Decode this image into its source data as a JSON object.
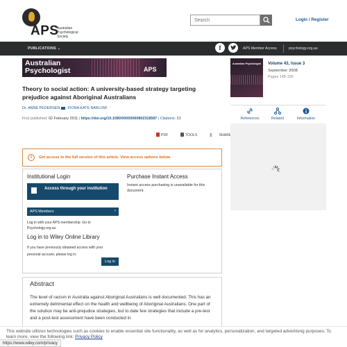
{
  "header": {
    "logo_text": "APS",
    "logo_society": "Australian Psychological Society",
    "search_placeholder": "Search",
    "login_label": "Login / Register"
  },
  "nav": {
    "publications_label": "PUBLICATIONS",
    "member_access_label": "APS Member Access",
    "site_label": "psychology.org.au",
    "facebook_glyph": "f"
  },
  "journal": {
    "banner_title_line1": "Australian",
    "banner_title_line2": "Psychologist",
    "banner_badge": "APS",
    "cover_title": "Australian Psychologist",
    "volume": "Volume 43, Issue 3",
    "issue_date": "September 2008",
    "pages": "Pages 148-159"
  },
  "article": {
    "title": "Theory to social action: A university-based strategy targeting prejudice against Aboriginal Australians",
    "author_1": "Dr. ANNE PEDERSEN",
    "author_2": "FIONA KATE BARLOW",
    "first_published_label": "First published:",
    "first_published_date": "02 February 2011",
    "doi": "https://doi.org/10.1080/00050060802318587",
    "citations": "Citations: 53"
  },
  "tools": {
    "pdf_label": "PDF",
    "tools_label": "TOOLS",
    "share_label": "SHARE"
  },
  "access": {
    "info_glyph": "i",
    "message": "Get access to the full version of this article. View access options below."
  },
  "login_box": {
    "institutional_heading": "Institutional Login",
    "institution_button": "Access through your institution",
    "aps_members_button": "APS Members",
    "membership_note": "Log in with your APS membership: Go to Psychology.org.au",
    "wiley_heading": "Log in to Wiley Online Library",
    "wiley_note": "If you have previously obtained access with your personal account, please log in.",
    "login_button": "Log in",
    "purchase_heading": "Purchase Instant Access",
    "purchase_text": "Instant access purchasing is unavailable for this document."
  },
  "abstract": {
    "heading": "Abstract",
    "body": "The level of racism in Australia against Aboriginal Australians is well documented. This has an extremely detrimental effect on the health and wellbeing of Aboriginal Australians. One part of the solution may be anti-prejudice strategies, but to date few strategies that include a pre-test and a post-test assessment have been conducted in"
  },
  "sidebar": {
    "tab_references": "References",
    "tab_related": "Related",
    "tab_information": "Information"
  },
  "cookie": {
    "text": "This website utilizes technologies such as cookies to enable essential site functionality, as well as for analytics, personalization, and targeted advertising purposes. To learn more, view the following link:",
    "link_label": "Privacy Policy"
  },
  "status_bar": {
    "url": "https://www.wiley.com/privacy"
  },
  "colors": {
    "nav_bg": "#2b2c2d",
    "link_blue": "#1a5a92",
    "button_navy": "#16496b",
    "access_orange": "#e06b20"
  }
}
